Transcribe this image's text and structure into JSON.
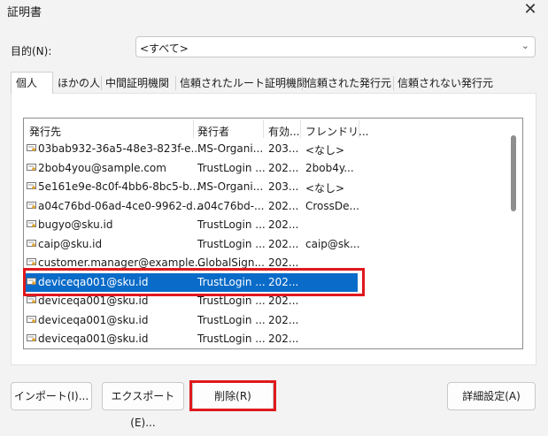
{
  "window": {
    "title": "証明書",
    "close_glyph": "✕"
  },
  "purpose": {
    "label": "目的(N):",
    "value": "<すべて>",
    "chevron": "⌄"
  },
  "tabs": [
    {
      "label": "個人",
      "active": true
    },
    {
      "label": "ほかの人"
    },
    {
      "label": "中間証明機関"
    },
    {
      "label": "信頼されたルート証明機関"
    },
    {
      "label": "信頼された発行元"
    },
    {
      "label": "信頼されない発行元"
    }
  ],
  "table": {
    "columns": [
      "発行先",
      "発行者",
      "有効...",
      "フレンドリ..."
    ],
    "rows": [
      {
        "issued_to": "03bab932-36a5-48e3-823f-e...",
        "issued_by": "MS-Organi...",
        "expires": "203...",
        "friendly": "<なし>"
      },
      {
        "issued_to": "2bob4you@sample.com",
        "issued_by": "TrustLogin ...",
        "expires": "202...",
        "friendly": "2bob4y..."
      },
      {
        "issued_to": "5e161e9e-8c0f-4bb6-8bc5-b...",
        "issued_by": "MS-Organi...",
        "expires": "203...",
        "friendly": "<なし>"
      },
      {
        "issued_to": "a04c76bd-06ad-4ce0-9962-d...",
        "issued_by": "a04c76bd-...",
        "expires": "202...",
        "friendly": "CrossDe..."
      },
      {
        "issued_to": "bugyo@sku.id",
        "issued_by": "TrustLogin ...",
        "expires": "202...",
        "friendly": ""
      },
      {
        "issued_to": "caip@sku.id",
        "issued_by": "TrustLogin ...",
        "expires": "202...",
        "friendly": "caip@sk..."
      },
      {
        "issued_to": "customer.manager@example...",
        "issued_by": "GlobalSign...",
        "expires": "202...",
        "friendly": ""
      },
      {
        "issued_to": "deviceqa001@sku.id",
        "issued_by": "TrustLogin ...",
        "expires": "202...",
        "friendly": "",
        "selected": true
      },
      {
        "issued_to": "deviceqa001@sku.id",
        "issued_by": "TrustLogin ...",
        "expires": "202...",
        "friendly": ""
      },
      {
        "issued_to": "deviceqa001@sku.id",
        "issued_by": "TrustLogin ...",
        "expires": "202...",
        "friendly": ""
      },
      {
        "issued_to": "deviceqa001@sku.id",
        "issued_by": "TrustLogin ...",
        "expires": "202...",
        "friendly": ""
      }
    ]
  },
  "buttons": {
    "import": "インポート(I)...",
    "export": "エクスポート(E)...",
    "delete": "削除(R)",
    "advanced": "詳細設定(A)"
  },
  "colors": {
    "selection": "#0a6bc8",
    "highlight": "#e0191d"
  }
}
